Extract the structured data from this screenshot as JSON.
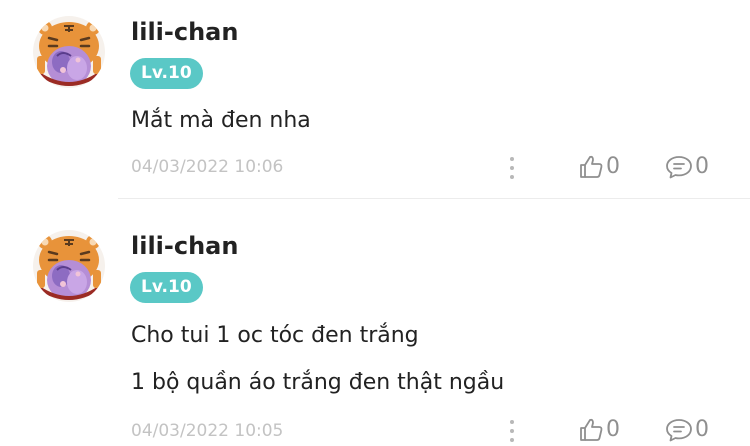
{
  "comments": [
    {
      "username": "lili-chan",
      "level": "Lv.10",
      "lines": [
        "Mắt mà đen nha"
      ],
      "timestamp": "04/03/2022 10:06",
      "likes": "0",
      "replies": "0"
    },
    {
      "username": "lili-chan",
      "level": "Lv.10",
      "lines": [
        "Cho tui 1 oc tóc đen trắng",
        "1 bộ quần áo trắng đen thật ngầu"
      ],
      "timestamp": "04/03/2022 10:05",
      "likes": "0",
      "replies": "0"
    }
  ],
  "icons": {
    "like": "thumbs-up-icon",
    "reply": "speech-bubble-icon",
    "more": "vertical-dots-icon",
    "avatar": "tiger-avatar"
  },
  "colors": {
    "level_badge": "#5ac8c6",
    "timestamp": "#c3c3c3",
    "action_gray": "#8f8f8f",
    "avatar_orange": "#e8933a"
  }
}
